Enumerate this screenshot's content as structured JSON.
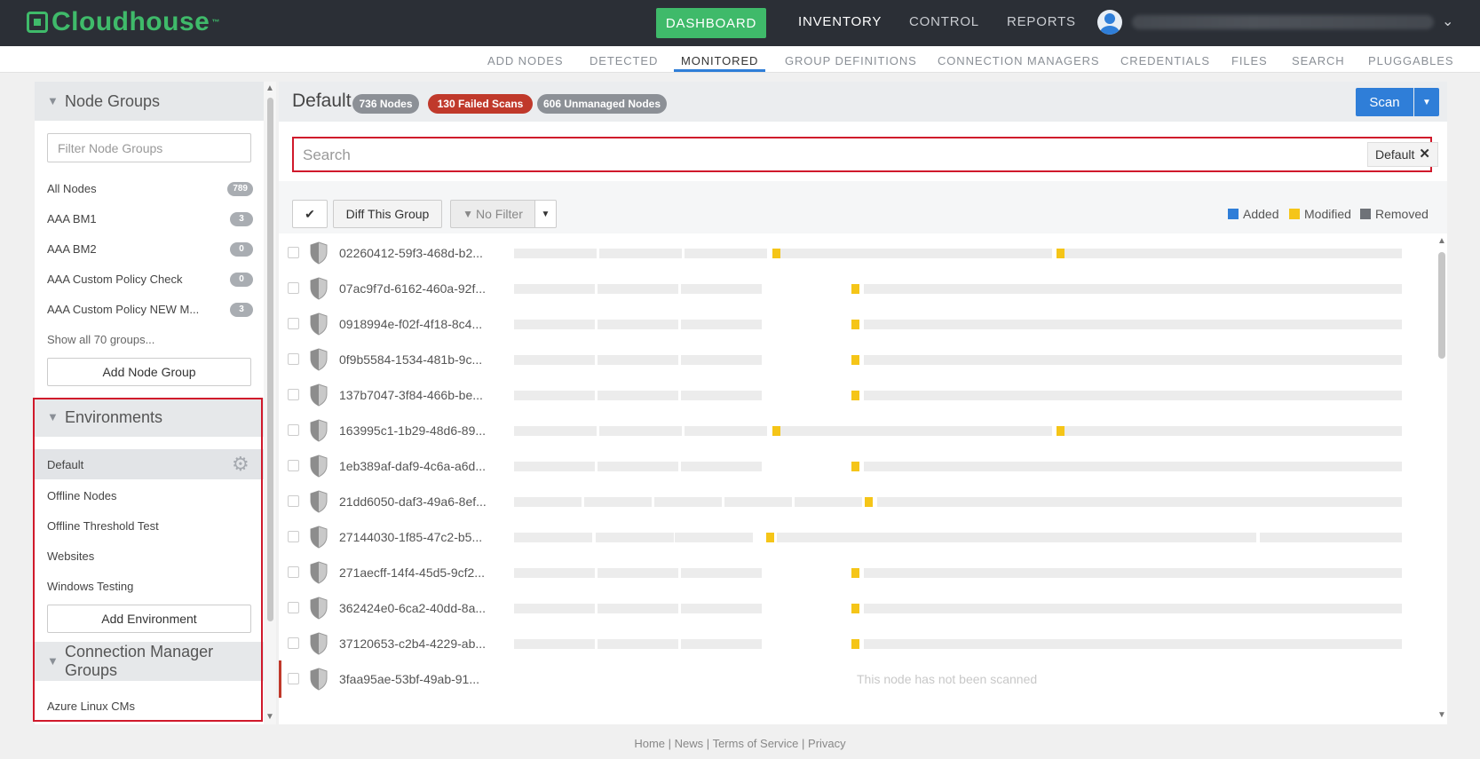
{
  "brand": {
    "name": "Cloudhouse",
    "tm": "™"
  },
  "topnav": {
    "dashboard": "DASHBOARD",
    "inventory": "INVENTORY",
    "control": "CONTROL",
    "reports": "REPORTS"
  },
  "subnav": [
    {
      "label": "ADD NODES",
      "active": false
    },
    {
      "label": "DETECTED",
      "active": false
    },
    {
      "label": "MONITORED",
      "active": true
    },
    {
      "label": "GROUP DEFINITIONS",
      "active": false
    },
    {
      "label": "CONNECTION MANAGERS",
      "active": false
    },
    {
      "label": "CREDENTIALS",
      "active": false
    },
    {
      "label": "FILES",
      "active": false
    },
    {
      "label": "SEARCH",
      "active": false
    },
    {
      "label": "PLUGGABLES",
      "active": false
    }
  ],
  "sidebar": {
    "node_groups": {
      "title": "Node Groups",
      "filter_placeholder": "Filter Node Groups",
      "items": [
        {
          "label": "All Nodes",
          "count": "789"
        },
        {
          "label": "AAA BM1",
          "count": "3"
        },
        {
          "label": "AAA BM2",
          "count": "0"
        },
        {
          "label": "AAA Custom Policy Check",
          "count": "0"
        },
        {
          "label": "AAA Custom Policy NEW M...",
          "count": "3"
        }
      ],
      "show_all": "Show all 70 groups...",
      "add_button": "Add Node Group"
    },
    "environments": {
      "title": "Environments",
      "items": [
        {
          "label": "Default",
          "selected": true
        },
        {
          "label": "Offline Nodes",
          "selected": false
        },
        {
          "label": "Offline Threshold Test",
          "selected": false
        },
        {
          "label": "Websites",
          "selected": false
        },
        {
          "label": "Windows Testing",
          "selected": false
        }
      ],
      "add_button": "Add Environment"
    },
    "connection_manager_groups": {
      "title": "Connection Manager Groups",
      "items": [
        {
          "label": "Azure Linux CMs"
        }
      ]
    }
  },
  "main": {
    "title": "Default",
    "badges": {
      "nodes": "736 Nodes",
      "failed": "130 Failed Scans",
      "unmanaged": "606 Unmanaged Nodes"
    },
    "scan_label": "Scan",
    "search": {
      "placeholder": "Search",
      "tag": "Default"
    },
    "toolbar": {
      "diff": "Diff This Group",
      "filter": "No Filter"
    },
    "legend": [
      {
        "label": "Added",
        "color": "#2f7ed8"
      },
      {
        "label": "Modified",
        "color": "#f5c518"
      },
      {
        "label": "Removed",
        "color": "#6e7278"
      }
    ],
    "not_scanned_text": "This node has not been scanned",
    "nodes": [
      {
        "id": "02260412-59f3-468d-b2...",
        "pattern": "A"
      },
      {
        "id": "07ac9f7d-6162-460a-92f...",
        "pattern": "B"
      },
      {
        "id": "0918994e-f02f-4f18-8c4...",
        "pattern": "B"
      },
      {
        "id": "0f9b5584-1534-481b-9c...",
        "pattern": "B"
      },
      {
        "id": "137b7047-3f84-466b-be...",
        "pattern": "B"
      },
      {
        "id": "163995c1-1b29-48d6-89...",
        "pattern": "A"
      },
      {
        "id": "1eb389af-daf9-4c6a-a6d...",
        "pattern": "B"
      },
      {
        "id": "21dd6050-daf3-49a6-8ef...",
        "pattern": "C"
      },
      {
        "id": "27144030-1f85-47c2-b5...",
        "pattern": "D"
      },
      {
        "id": "271aecff-14f4-45d5-9cf2...",
        "pattern": "B"
      },
      {
        "id": "362424e0-6ca2-40dd-8a...",
        "pattern": "B"
      },
      {
        "id": "37120653-c2b4-4229-ab...",
        "pattern": "B"
      },
      {
        "id": "3faa95ae-53bf-49ab-91...",
        "pattern": "none"
      }
    ]
  },
  "footer": {
    "home": "Home",
    "news": "News",
    "terms": "Terms of Service",
    "privacy": "Privacy",
    "sep": "|"
  }
}
